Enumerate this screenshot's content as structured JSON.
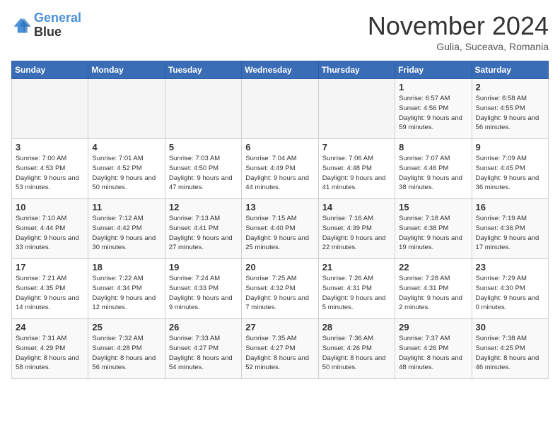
{
  "logo": {
    "line1": "General",
    "line2": "Blue"
  },
  "title": "November 2024",
  "subtitle": "Gulia, Suceava, Romania",
  "headers": [
    "Sunday",
    "Monday",
    "Tuesday",
    "Wednesday",
    "Thursday",
    "Friday",
    "Saturday"
  ],
  "weeks": [
    [
      {
        "day": "",
        "info": ""
      },
      {
        "day": "",
        "info": ""
      },
      {
        "day": "",
        "info": ""
      },
      {
        "day": "",
        "info": ""
      },
      {
        "day": "",
        "info": ""
      },
      {
        "day": "1",
        "info": "Sunrise: 6:57 AM\nSunset: 4:56 PM\nDaylight: 9 hours and 59 minutes."
      },
      {
        "day": "2",
        "info": "Sunrise: 6:58 AM\nSunset: 4:55 PM\nDaylight: 9 hours and 56 minutes."
      }
    ],
    [
      {
        "day": "3",
        "info": "Sunrise: 7:00 AM\nSunset: 4:53 PM\nDaylight: 9 hours and 53 minutes."
      },
      {
        "day": "4",
        "info": "Sunrise: 7:01 AM\nSunset: 4:52 PM\nDaylight: 9 hours and 50 minutes."
      },
      {
        "day": "5",
        "info": "Sunrise: 7:03 AM\nSunset: 4:50 PM\nDaylight: 9 hours and 47 minutes."
      },
      {
        "day": "6",
        "info": "Sunrise: 7:04 AM\nSunset: 4:49 PM\nDaylight: 9 hours and 44 minutes."
      },
      {
        "day": "7",
        "info": "Sunrise: 7:06 AM\nSunset: 4:48 PM\nDaylight: 9 hours and 41 minutes."
      },
      {
        "day": "8",
        "info": "Sunrise: 7:07 AM\nSunset: 4:46 PM\nDaylight: 9 hours and 38 minutes."
      },
      {
        "day": "9",
        "info": "Sunrise: 7:09 AM\nSunset: 4:45 PM\nDaylight: 9 hours and 36 minutes."
      }
    ],
    [
      {
        "day": "10",
        "info": "Sunrise: 7:10 AM\nSunset: 4:44 PM\nDaylight: 9 hours and 33 minutes."
      },
      {
        "day": "11",
        "info": "Sunrise: 7:12 AM\nSunset: 4:42 PM\nDaylight: 9 hours and 30 minutes."
      },
      {
        "day": "12",
        "info": "Sunrise: 7:13 AM\nSunset: 4:41 PM\nDaylight: 9 hours and 27 minutes."
      },
      {
        "day": "13",
        "info": "Sunrise: 7:15 AM\nSunset: 4:40 PM\nDaylight: 9 hours and 25 minutes."
      },
      {
        "day": "14",
        "info": "Sunrise: 7:16 AM\nSunset: 4:39 PM\nDaylight: 9 hours and 22 minutes."
      },
      {
        "day": "15",
        "info": "Sunrise: 7:18 AM\nSunset: 4:38 PM\nDaylight: 9 hours and 19 minutes."
      },
      {
        "day": "16",
        "info": "Sunrise: 7:19 AM\nSunset: 4:36 PM\nDaylight: 9 hours and 17 minutes."
      }
    ],
    [
      {
        "day": "17",
        "info": "Sunrise: 7:21 AM\nSunset: 4:35 PM\nDaylight: 9 hours and 14 minutes."
      },
      {
        "day": "18",
        "info": "Sunrise: 7:22 AM\nSunset: 4:34 PM\nDaylight: 9 hours and 12 minutes."
      },
      {
        "day": "19",
        "info": "Sunrise: 7:24 AM\nSunset: 4:33 PM\nDaylight: 9 hours and 9 minutes."
      },
      {
        "day": "20",
        "info": "Sunrise: 7:25 AM\nSunset: 4:32 PM\nDaylight: 9 hours and 7 minutes."
      },
      {
        "day": "21",
        "info": "Sunrise: 7:26 AM\nSunset: 4:31 PM\nDaylight: 9 hours and 5 minutes."
      },
      {
        "day": "22",
        "info": "Sunrise: 7:28 AM\nSunset: 4:31 PM\nDaylight: 9 hours and 2 minutes."
      },
      {
        "day": "23",
        "info": "Sunrise: 7:29 AM\nSunset: 4:30 PM\nDaylight: 9 hours and 0 minutes."
      }
    ],
    [
      {
        "day": "24",
        "info": "Sunrise: 7:31 AM\nSunset: 4:29 PM\nDaylight: 8 hours and 58 minutes."
      },
      {
        "day": "25",
        "info": "Sunrise: 7:32 AM\nSunset: 4:28 PM\nDaylight: 8 hours and 56 minutes."
      },
      {
        "day": "26",
        "info": "Sunrise: 7:33 AM\nSunset: 4:27 PM\nDaylight: 8 hours and 54 minutes."
      },
      {
        "day": "27",
        "info": "Sunrise: 7:35 AM\nSunset: 4:27 PM\nDaylight: 8 hours and 52 minutes."
      },
      {
        "day": "28",
        "info": "Sunrise: 7:36 AM\nSunset: 4:26 PM\nDaylight: 8 hours and 50 minutes."
      },
      {
        "day": "29",
        "info": "Sunrise: 7:37 AM\nSunset: 4:26 PM\nDaylight: 8 hours and 48 minutes."
      },
      {
        "day": "30",
        "info": "Sunrise: 7:38 AM\nSunset: 4:25 PM\nDaylight: 8 hours and 46 minutes."
      }
    ]
  ]
}
